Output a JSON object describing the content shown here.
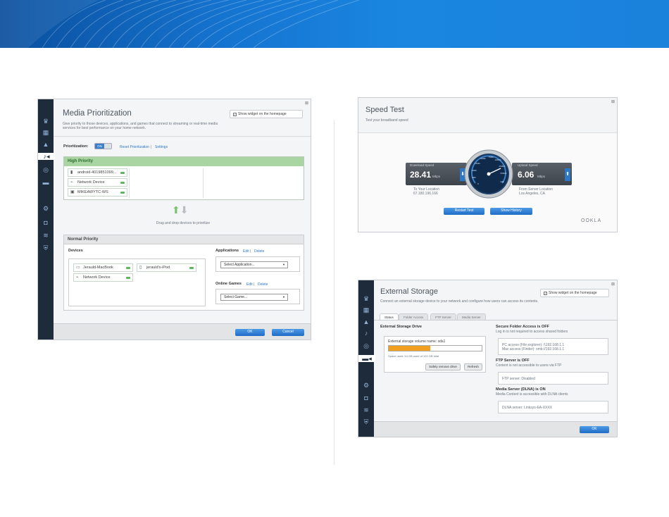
{
  "media": {
    "title": "Media Prioritization",
    "description": "Give priority to those devices, applications, and games that connect to streaming or real-time media services for best performance on your home network.",
    "show_widget": "Show widget on the homepage",
    "prioritization_label": "Prioritization:",
    "toggle_on": "ON",
    "reset_link": "Reset Prioritization",
    "settings_link": "Settings",
    "high_priority": "High Priority",
    "high_devices": [
      {
        "name": "android-4019851099...",
        "icon": "phone-icon"
      },
      {
        "name": "Network Device",
        "icon": "network-device-icon"
      },
      {
        "name": "MIKEAWYTC-WS",
        "icon": "desktop-icon"
      }
    ],
    "drag_hint": "Drag and drop devices to prioritize",
    "normal_priority": "Normal Priority",
    "devices_label": "Devices",
    "normal_devices": [
      {
        "name": "Jerauld-MacBook",
        "icon": "laptop-icon"
      },
      {
        "name": "Network Device",
        "icon": "network-device-icon"
      },
      {
        "name": "jerauld's-iPod",
        "icon": "ipod-icon"
      }
    ],
    "applications_label": "Applications",
    "edit": "Edit",
    "delete": "Delete",
    "select_application": "Select Application...",
    "online_games_label": "Online Games",
    "select_game": "Select Game...",
    "ok": "OK",
    "cancel": "Cancel"
  },
  "speed": {
    "title": "Speed Test",
    "subtitle": "Test your broadband speed",
    "download_label": "Download Speed",
    "download_value": "28.41",
    "download_unit": "Mbps",
    "to_location_1": "To Your Location",
    "to_location_2": "67.180.196.166",
    "upload_label": "Upload Speed",
    "upload_value": "6.06",
    "upload_unit": "Mbps",
    "from_location_1": "From Server Location",
    "from_location_2": "Los Angeles, CA",
    "gauge_ticks": [
      "0",
      "5Mb",
      "10Mb",
      "25Mb",
      "50Mb",
      "75Mb",
      "100Mb",
      "250Mb",
      "500Mb",
      "1Gb"
    ],
    "restart": "Restart Test",
    "history": "Show History",
    "brand": "OOKLA"
  },
  "storage": {
    "title": "External Storage",
    "description": "Connect an external storage device to your network and configure how users can access its contents.",
    "show_widget": "Show widget on the homepage",
    "tabs": [
      "Status",
      "Folder Access",
      "FTP Server",
      "Media Server"
    ],
    "drive_heading": "External Storage Drive",
    "volume_name": "External storage volume name: sda1",
    "usage_fraction": 0.45,
    "usage_text": "Space used: 54 GB used of 120 GB total",
    "safely_remove": "Safely remove drive",
    "refresh": "Refresh",
    "secure_heading": "Secure Folder Access is OFF",
    "secure_sub": "Log in is not required to access shared folders",
    "pc_access": "PC access (File explorer): \\\\192.168.1.1",
    "mac_access": "Mac access (Finder): smb://192.168.1.1",
    "ftp_heading": "FTP Server is OFF",
    "ftp_sub": "Content is not accessible to users via FTP",
    "ftp_box": "FTP server: Disabled",
    "media_heading": "Media Server (DLNA) is ON",
    "media_sub": "Media Content is accessible with DLNA clients",
    "dlna_box": "DLNA server: Linksys-EA-XXXX",
    "ok": "OK"
  }
}
